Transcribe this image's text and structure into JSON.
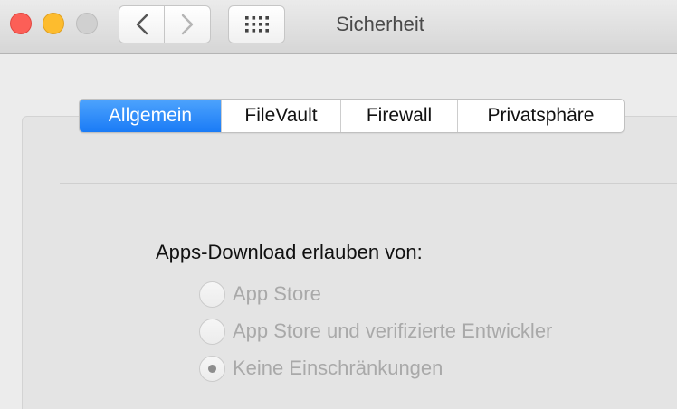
{
  "window": {
    "title": "Sicherheit"
  },
  "toolbar": {
    "back_icon": "chevron-left-icon",
    "forward_icon": "chevron-right-icon",
    "grid_icon": "show-all-grid-icon"
  },
  "tabs": [
    {
      "label": "Allgemein",
      "active": true
    },
    {
      "label": "FileVault",
      "active": false
    },
    {
      "label": "Firewall",
      "active": false
    },
    {
      "label": "Privatsphäre",
      "active": false
    }
  ],
  "general": {
    "heading": "Apps-Download erlauben von:",
    "options": [
      {
        "label": "App Store",
        "selected": false,
        "enabled": false
      },
      {
        "label": "App Store und verifizierte Entwickler",
        "selected": false,
        "enabled": false
      },
      {
        "label": "Keine Einschränkungen",
        "selected": true,
        "enabled": false
      }
    ]
  },
  "colors": {
    "accent": "#1a7bf6",
    "close": "#fc5f57",
    "minimize": "#fdbc2e",
    "disabled_text": "#a9a9a9"
  }
}
